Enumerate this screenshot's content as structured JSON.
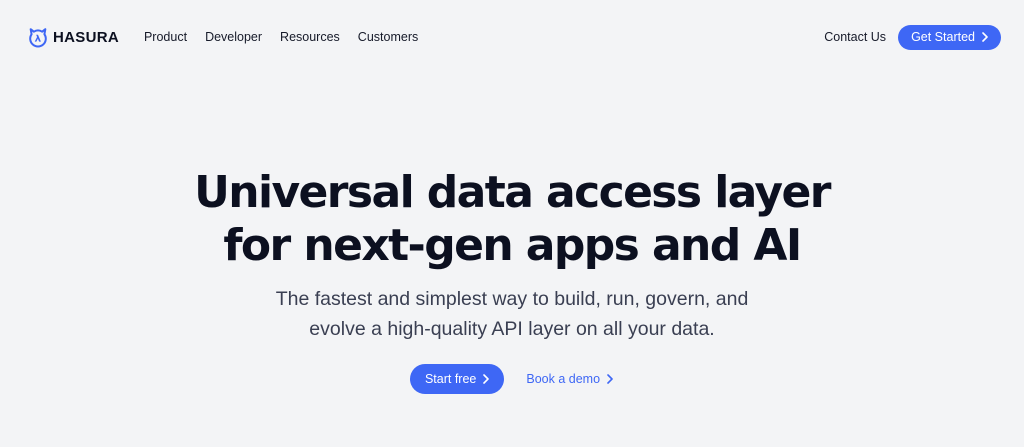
{
  "brand": {
    "name": "HASURA",
    "icon": "hasura-logo-icon",
    "color": "#3e67f5"
  },
  "nav": {
    "items": [
      {
        "label": "Product"
      },
      {
        "label": "Developer"
      },
      {
        "label": "Resources"
      },
      {
        "label": "Customers"
      }
    ],
    "contact_label": "Contact Us",
    "cta_label": "Get Started"
  },
  "hero": {
    "title_line_1": "Universal data access layer",
    "title_line_2": "for next-gen apps and AI",
    "subtitle_line_1": "The fastest and simplest way to build, run, govern, and",
    "subtitle_line_2": "evolve a high-quality API layer on all your data.",
    "primary_label": "Start free",
    "secondary_label": "Book a demo"
  },
  "colors": {
    "background": "#f3f4f6",
    "accent": "#3e67f5",
    "text": "#0c1020"
  }
}
